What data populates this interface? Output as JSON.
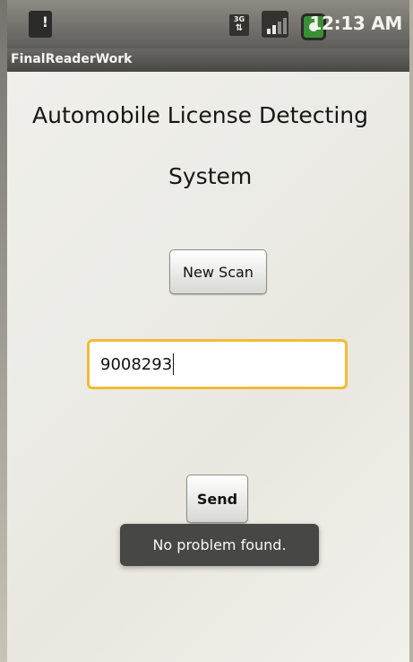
{
  "status_bar": {
    "time": "12:13 AM",
    "icons": [
      "sd-card-warning-icon",
      "3g-data-icon",
      "signal-icon",
      "battery-charging-icon"
    ],
    "network_label": "3G"
  },
  "app": {
    "title": "FinalReaderWork"
  },
  "main": {
    "heading_line1": "Automobile License Detecting",
    "heading_line2": "System",
    "new_scan_label": "New Scan",
    "plate_value": "9008293",
    "send_label": "Send",
    "toast_message": "No problem found."
  },
  "colors": {
    "field_focus": "#f0bb38",
    "toast_background": "#474745"
  }
}
